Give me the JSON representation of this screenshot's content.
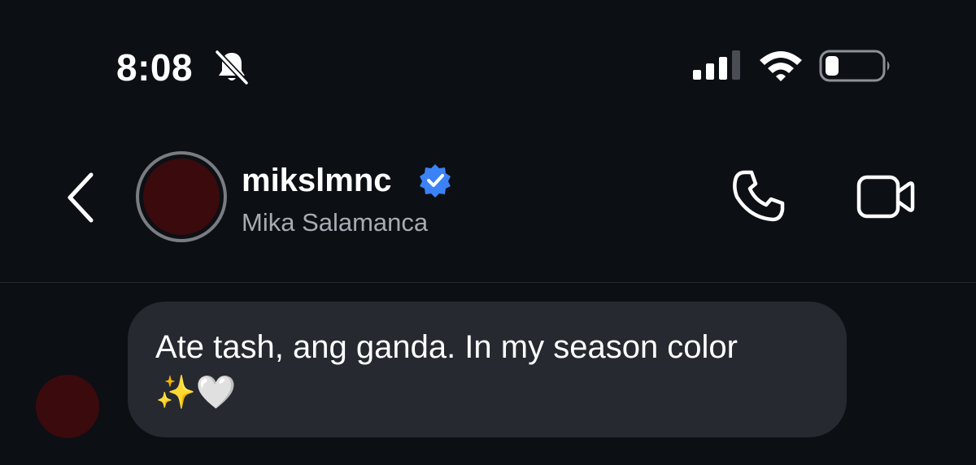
{
  "status_bar": {
    "time": "8:08",
    "icons": [
      "bell-slash-icon",
      "signal-icon",
      "wifi-icon",
      "battery-icon"
    ]
  },
  "header": {
    "username": "mikslmnc",
    "full_name": "Mika Salamanca",
    "verified": true,
    "icons": [
      "back-icon",
      "verified-badge-icon",
      "phone-icon",
      "video-camera-icon"
    ]
  },
  "message": {
    "text": "Ate tash, ang ganda. In my season color\n✨🤍"
  },
  "colors": {
    "background": "#0c0f14",
    "bubble": "#26292f",
    "avatar": "#3b0a0d",
    "verified_blue": "#3b82f6",
    "secondary_text": "#a8abb2"
  }
}
